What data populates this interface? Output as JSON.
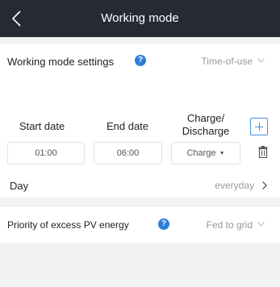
{
  "header": {
    "title": "Working mode"
  },
  "working_mode": {
    "label": "Working mode settings",
    "help_glyph": "?",
    "value": "Time-of-use"
  },
  "schedule": {
    "columns": {
      "start_date": "Start date",
      "end_date": "End date",
      "charge_line1": "Charge/",
      "charge_line2": "Discharge"
    },
    "entry": {
      "start": "01:00",
      "end": "06:00",
      "mode": "Charge"
    },
    "day_label": "Day",
    "day_value": "everyday"
  },
  "excess_pv": {
    "label": "Priority of excess PV energy",
    "help_glyph": "?",
    "value": "Fed to grid"
  },
  "colors": {
    "header_bg": "#252a34",
    "accent": "#2f7ed8",
    "background": "#f2f2f2"
  }
}
